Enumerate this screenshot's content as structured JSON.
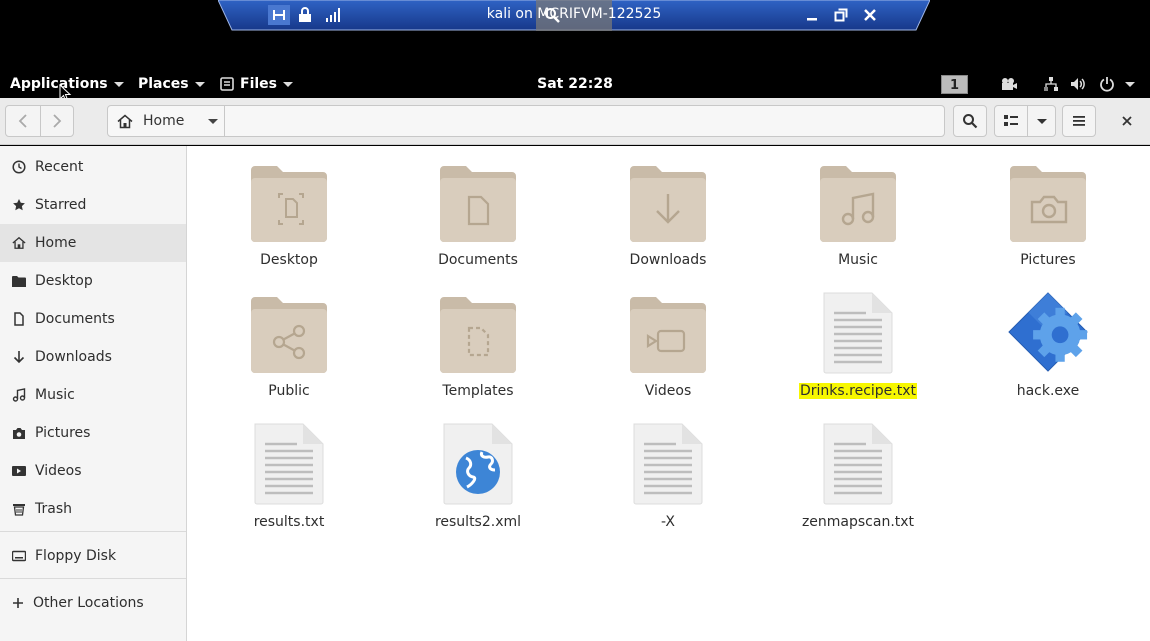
{
  "remote_session": {
    "title": "kali on MCRIFVM-122525"
  },
  "topbar": {
    "applications": "Applications",
    "places": "Places",
    "files": "Files",
    "clock": "Sat 22:28",
    "workspace": "1"
  },
  "header": {
    "location": "Home"
  },
  "sidebar": {
    "items": [
      {
        "label": "Recent",
        "icon": "clock-icon"
      },
      {
        "label": "Starred",
        "icon": "star-icon"
      },
      {
        "label": "Home",
        "icon": "home-icon",
        "active": true
      },
      {
        "label": "Desktop",
        "icon": "folder-icon"
      },
      {
        "label": "Documents",
        "icon": "document-icon"
      },
      {
        "label": "Downloads",
        "icon": "download-icon"
      },
      {
        "label": "Music",
        "icon": "music-icon"
      },
      {
        "label": "Pictures",
        "icon": "camera-icon"
      },
      {
        "label": "Videos",
        "icon": "video-icon"
      },
      {
        "label": "Trash",
        "icon": "trash-icon"
      },
      {
        "label": "Floppy Disk",
        "icon": "disk-icon"
      },
      {
        "label": "Other Locations",
        "icon": "plus-icon"
      }
    ]
  },
  "files": [
    {
      "name": "Desktop",
      "type": "folder-desktop"
    },
    {
      "name": "Documents",
      "type": "folder-documents"
    },
    {
      "name": "Downloads",
      "type": "folder-downloads"
    },
    {
      "name": "Music",
      "type": "folder-music"
    },
    {
      "name": "Pictures",
      "type": "folder-pictures"
    },
    {
      "name": "Public",
      "type": "folder-public"
    },
    {
      "name": "Templates",
      "type": "folder-templates"
    },
    {
      "name": "Videos",
      "type": "folder-videos"
    },
    {
      "name": "Drinks.recipe.txt",
      "type": "text",
      "highlighted": true
    },
    {
      "name": "hack.exe",
      "type": "executable"
    },
    {
      "name": "results.txt",
      "type": "text"
    },
    {
      "name": "results2.xml",
      "type": "xml"
    },
    {
      "name": "-X",
      "type": "text"
    },
    {
      "name": "zenmapscan.txt",
      "type": "text"
    }
  ],
  "colors": {
    "folder": "#d6c9b8",
    "folder_glyph": "#b8a994",
    "highlight": "#f7f700",
    "exe_blue": "#3c82d8"
  }
}
